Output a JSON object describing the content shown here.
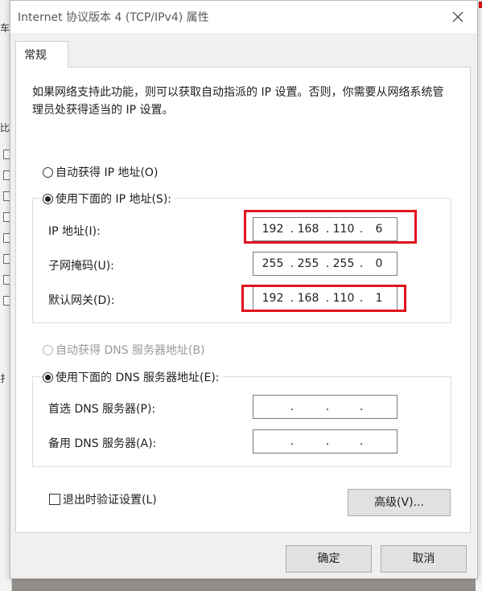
{
  "window": {
    "title": "Internet 协议版本 4 (TCP/IPv4) 属性"
  },
  "tabs": [
    {
      "label": "常规",
      "active": true
    }
  ],
  "intro_text": "如果网络支持此功能，则可以获取自动指派的 IP 设置。否则，你需要从网络系统管理员处获得适当的 IP 设置。",
  "ip_section": {
    "auto_label": "自动获得 IP 地址(O)",
    "manual_label": "使用下面的 IP 地址(S):",
    "selected": "manual",
    "fields": [
      {
        "label": "IP 地址(I):",
        "octets": [
          "192",
          "168",
          "110",
          "6"
        ],
        "highlighted": true
      },
      {
        "label": "子网掩码(U):",
        "octets": [
          "255",
          "255",
          "255",
          "0"
        ],
        "highlighted": false
      },
      {
        "label": "默认网关(D):",
        "octets": [
          "192",
          "168",
          "110",
          "1"
        ],
        "highlighted": true
      }
    ]
  },
  "dns_section": {
    "auto_label": "自动获得 DNS 服务器地址(B)",
    "manual_label": "使用下面的 DNS 服务器地址(E):",
    "selected": "manual",
    "auto_disabled": true,
    "fields": [
      {
        "label": "首选 DNS 服务器(P):",
        "octets": [
          "",
          "",
          "",
          ""
        ]
      },
      {
        "label": "备用 DNS 服务器(A):",
        "octets": [
          "",
          "",
          "",
          ""
        ]
      }
    ]
  },
  "validate_on_exit": {
    "label": "退出时验证设置(L)",
    "checked": false
  },
  "buttons": {
    "advanced": "高级(V)...",
    "ok": "确定",
    "cancel": "取消"
  },
  "behind_window": {
    "chars": [
      "车",
      "比",
      "扌"
    ]
  },
  "colors": {
    "highlight_box": "#e0141e",
    "dialog_bg": "#f0f0f0",
    "panel_bg": "#ffffff"
  },
  "icons": {
    "close": "close-icon"
  }
}
